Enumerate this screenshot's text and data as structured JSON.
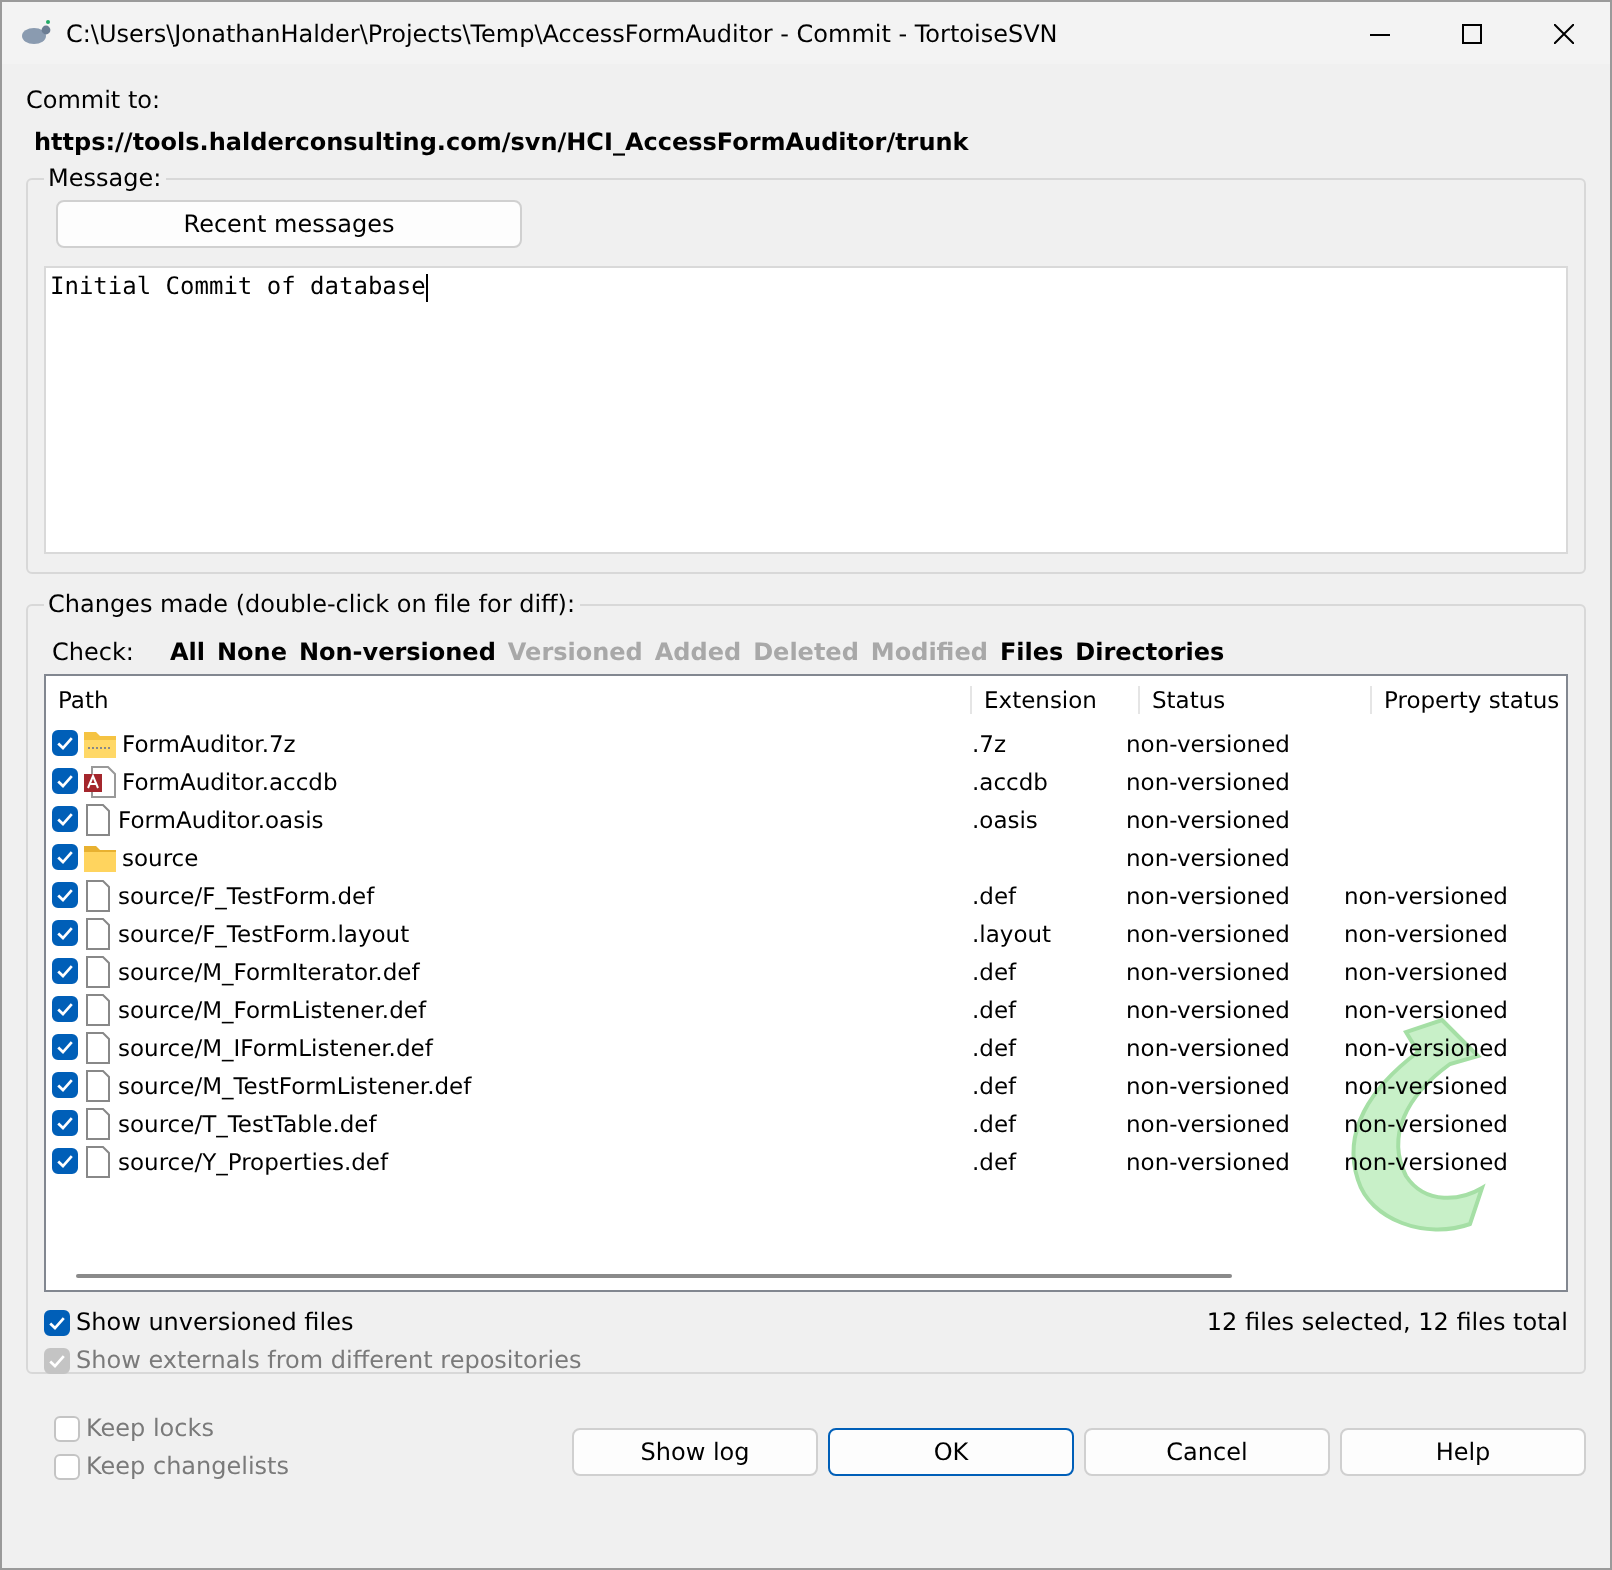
{
  "window": {
    "title": "C:\\Users\\JonathanHalder\\Projects\\Temp\\AccessFormAuditor - Commit - TortoiseSVN"
  },
  "commit_to": {
    "label": "Commit to:",
    "url": "https://tools.halderconsulting.com/svn/HCI_AccessFormAuditor/trunk"
  },
  "message": {
    "label": "Message:",
    "recent_button": "Recent messages",
    "value": "Initial Commit of database"
  },
  "changes": {
    "label": "Changes made (double-click on file for diff):",
    "check_label": "Check:",
    "filters": [
      {
        "label": "All",
        "disabled": false
      },
      {
        "label": "None",
        "disabled": false
      },
      {
        "label": "Non-versioned",
        "disabled": false
      },
      {
        "label": "Versioned",
        "disabled": true
      },
      {
        "label": "Added",
        "disabled": true
      },
      {
        "label": "Deleted",
        "disabled": true
      },
      {
        "label": "Modified",
        "disabled": true
      },
      {
        "label": "Files",
        "disabled": false
      },
      {
        "label": "Directories",
        "disabled": false
      }
    ],
    "columns": [
      "Path",
      "Extension",
      "Status",
      "Property status"
    ],
    "rows": [
      {
        "kind": "archive",
        "checked": true,
        "path": "FormAuditor.7z",
        "extension": ".7z",
        "status": "non-versioned"
      },
      {
        "kind": "access",
        "checked": true,
        "path": "FormAuditor.accdb",
        "extension": ".accdb",
        "status": "non-versioned"
      },
      {
        "kind": "file",
        "checked": true,
        "path": "FormAuditor.oasis",
        "extension": ".oasis",
        "status": "non-versioned"
      },
      {
        "kind": "folder",
        "checked": true,
        "path": "source",
        "status": "non-versioned"
      },
      {
        "kind": "file",
        "checked": true,
        "path": "source/F_TestForm.def",
        "extension": ".def",
        "status": "non-versioned",
        "property_status": "non-versioned"
      },
      {
        "kind": "file",
        "checked": true,
        "path": "source/F_TestForm.layout",
        "extension": ".layout",
        "status": "non-versioned",
        "property_status": "non-versioned"
      },
      {
        "kind": "file",
        "checked": true,
        "path": "source/M_FormIterator.def",
        "extension": ".def",
        "status": "non-versioned",
        "property_status": "non-versioned"
      },
      {
        "kind": "file",
        "checked": true,
        "path": "source/M_FormListener.def",
        "extension": ".def",
        "status": "non-versioned",
        "property_status": "non-versioned"
      },
      {
        "kind": "file",
        "checked": true,
        "path": "source/M_IFormListener.def",
        "extension": ".def",
        "status": "non-versioned",
        "property_status": "non-versioned"
      },
      {
        "kind": "file",
        "checked": true,
        "path": "source/M_TestFormListener.def",
        "extension": ".def",
        "status": "non-versioned",
        "property_status": "non-versioned"
      },
      {
        "kind": "file",
        "checked": true,
        "path": "source/T_TestTable.def",
        "extension": ".def",
        "status": "non-versioned",
        "property_status": "non-versioned"
      },
      {
        "kind": "file",
        "checked": true,
        "path": "source/Y_Properties.def",
        "extension": ".def",
        "status": "non-versioned",
        "property_status": "non-versioned"
      }
    ],
    "options": [
      {
        "label": "Show unversioned files",
        "checked": true,
        "disabled": false
      },
      {
        "label": "Show externals from different repositories",
        "checked": true,
        "disabled": true
      }
    ],
    "summary": "12 files selected, 12 files total"
  },
  "bottom_options": [
    {
      "label": "Keep locks",
      "checked": false,
      "disabled": true
    },
    {
      "label": "Keep changelists",
      "checked": false,
      "disabled": true
    }
  ],
  "buttons": [
    {
      "label": "Show log",
      "default": false
    },
    {
      "label": "OK",
      "default": true
    },
    {
      "label": "Cancel",
      "default": false
    },
    {
      "label": "Help",
      "default": false
    }
  ]
}
